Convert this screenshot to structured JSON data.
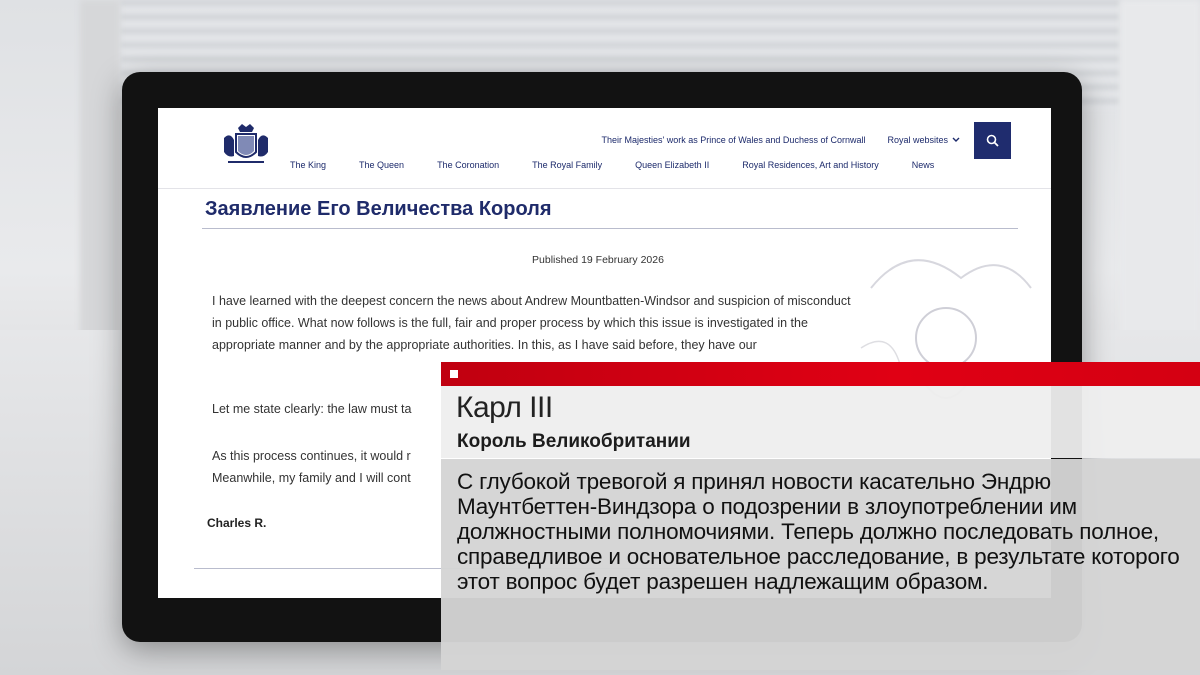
{
  "website": {
    "top_links": {
      "prince_wales": "Their Majesties' work as Prince of Wales and Duchess of Cornwall",
      "royal_websites": "Royal websites"
    },
    "nav": [
      "The King",
      "The Queen",
      "The Coronation",
      "The Royal Family",
      "Queen Elizabeth II",
      "Royal Residences, Art and History",
      "News"
    ],
    "title": "Заявление Его Величества Короля",
    "published": "Published 19 February 2026",
    "paragraphs": [
      "I have learned with the deepest concern the news about Andrew Mountbatten-Windsor and suspicion of misconduct in public office. What now follows is the full, fair and proper process by which this issue is investigated in the appropriate manner and by the appropriate authorities. In this, as I have said before, they have our",
      "Let me state clearly: the law must ta",
      "As this process continues, it would r\nMeanwhile, my family and I will cont"
    ],
    "signature": "Charles R."
  },
  "overlay": {
    "accent_color": "#d00012",
    "speaker_name": "Карл III",
    "speaker_title": "Король Великобритании",
    "quote": "С глубокой тревогой я принял новости касательно Эндрю Маунтбеттен-Виндзора о подозрении в злоупотреблении им должностными полномочиями. Теперь должно последовать полное, справедливое и основательное расследование, в результате которого этот вопрос будет разрешен надлежащим образом."
  },
  "icons": {
    "logo": "royal-crest-icon",
    "search": "search-icon",
    "dropdown": "chevron-down-icon"
  }
}
